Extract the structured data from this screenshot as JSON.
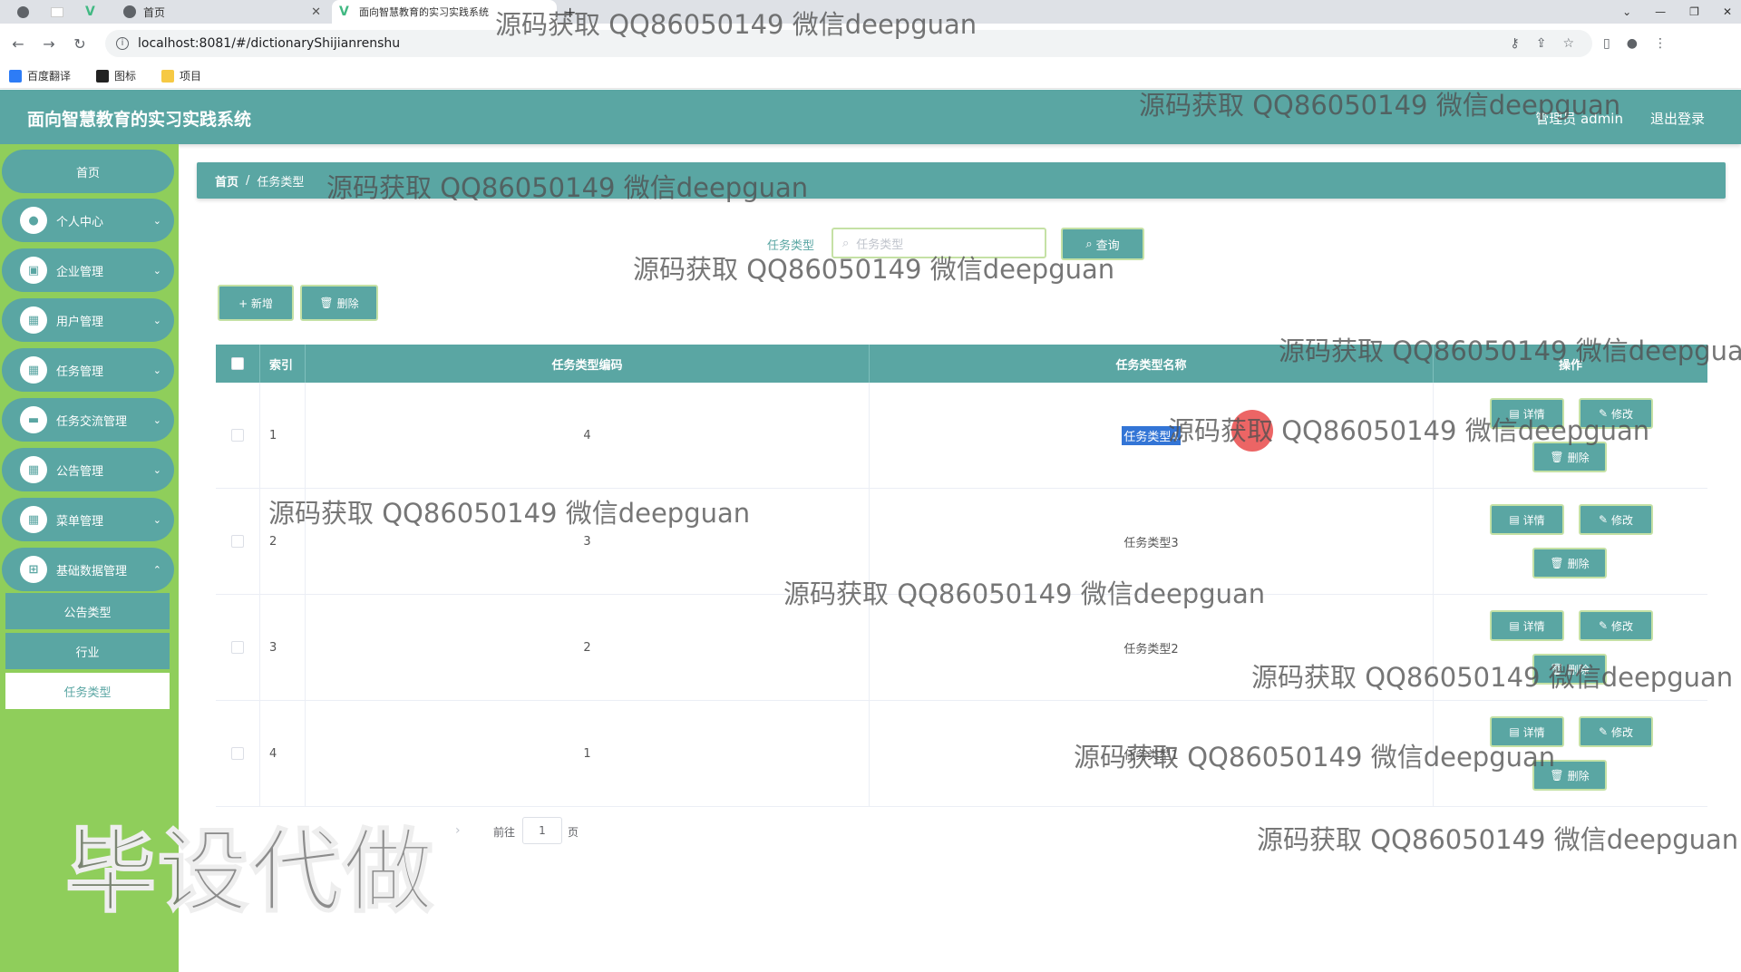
{
  "browser": {
    "tabs": [
      {
        "label": ""
      },
      {
        "label": ""
      },
      {
        "label": ""
      },
      {
        "label": "首页"
      },
      {
        "label": "面向智慧教育的实习实践系统"
      }
    ],
    "new_tab": "+",
    "url": "localhost:8081/#/dictionaryShijianrenshu",
    "bookmarks": [
      "百度翻译",
      "图标",
      "项目"
    ]
  },
  "header": {
    "title": "面向智慧教育的实习实践系统",
    "user": "管理员 admin",
    "logout": "退出登录"
  },
  "sidebar": {
    "home": "首页",
    "items": [
      {
        "label": "个人中心"
      },
      {
        "label": "企业管理"
      },
      {
        "label": "用户管理"
      },
      {
        "label": "任务管理"
      },
      {
        "label": "任务交流管理"
      },
      {
        "label": "公告管理"
      },
      {
        "label": "菜单管理"
      },
      {
        "label": "基础数据管理"
      }
    ],
    "submenu": [
      {
        "label": "公告类型"
      },
      {
        "label": "行业"
      },
      {
        "label": "任务类型"
      }
    ]
  },
  "breadcrumb": {
    "home": "首页",
    "sep": "/",
    "current": "任务类型"
  },
  "search": {
    "label": "任务类型",
    "placeholder": "任务类型",
    "button": "查询"
  },
  "actions": {
    "add": "+ 新增",
    "delete": "删除"
  },
  "table": {
    "headers": {
      "index": "索引",
      "code": "任务类型编码",
      "name": "任务类型名称",
      "ops": "操作"
    },
    "rows": [
      {
        "index": "1",
        "code": "4",
        "name": "任务类型4"
      },
      {
        "index": "2",
        "code": "3",
        "name": "任务类型3"
      },
      {
        "index": "3",
        "code": "2",
        "name": "任务类型2"
      },
      {
        "index": "4",
        "code": "1",
        "name": "任务类型1"
      }
    ],
    "op_labels": {
      "detail": "详情",
      "edit": "修改",
      "delete": "删除"
    }
  },
  "pagination": {
    "goto_label": "前往",
    "page": "1",
    "suffix": "页"
  },
  "watermark": {
    "text": "源码获取 QQ86050149 微信deepguan",
    "big": "毕设代做"
  },
  "colors": {
    "primary": "#5aa6a3",
    "sidebar": "#8fce5b",
    "border_accent": "#c5e1a5"
  }
}
